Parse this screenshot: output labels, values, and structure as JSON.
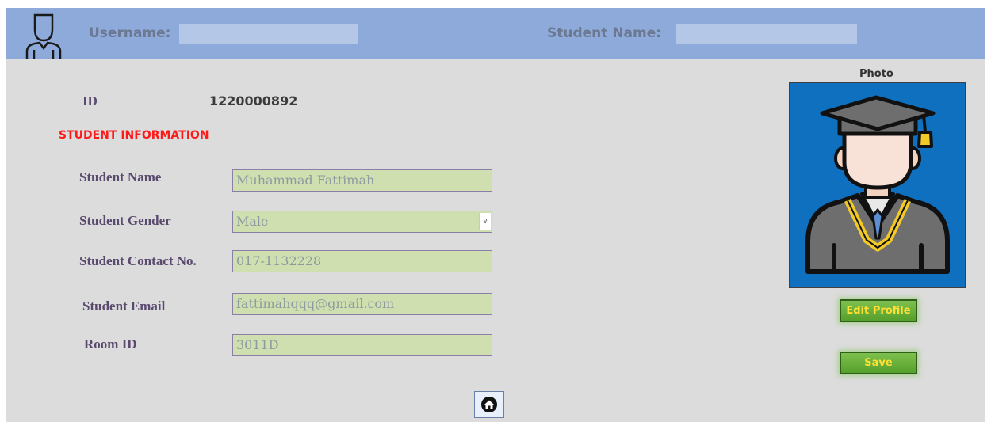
{
  "header": {
    "username_label": "Username:",
    "username_value": "",
    "student_name_label": "Student Name:",
    "student_name_value": "",
    "icon": "user-outline-icon"
  },
  "id": {
    "label": "ID",
    "value": "1220000892"
  },
  "section_title": "STUDENT INFORMATION",
  "fields": {
    "name": {
      "label": "Student Name",
      "value": "Muhammad Fattimah"
    },
    "gender": {
      "label": "Student Gender",
      "value": "Male"
    },
    "contact": {
      "label": "Student Contact No.",
      "value": "017-1132228"
    },
    "email": {
      "label": "Student Email",
      "value": "fattimahqqq@gmail.com"
    },
    "room": {
      "label": "Room ID",
      "value": "3011D"
    }
  },
  "photo": {
    "label": "Photo",
    "icon": "graduate-avatar-icon"
  },
  "buttons": {
    "edit_profile": "Edit Profile",
    "save": "Save",
    "home_icon": "home-icon"
  },
  "colors": {
    "header_bg": "#8eaadb",
    "panel_bg": "#dcdcdc",
    "field_bg": "#cfdfb0",
    "photo_bg": "#0f70c0",
    "button_bg": "#6bb03c",
    "button_text": "#ffe033",
    "section_title": "#ff1a1a"
  }
}
